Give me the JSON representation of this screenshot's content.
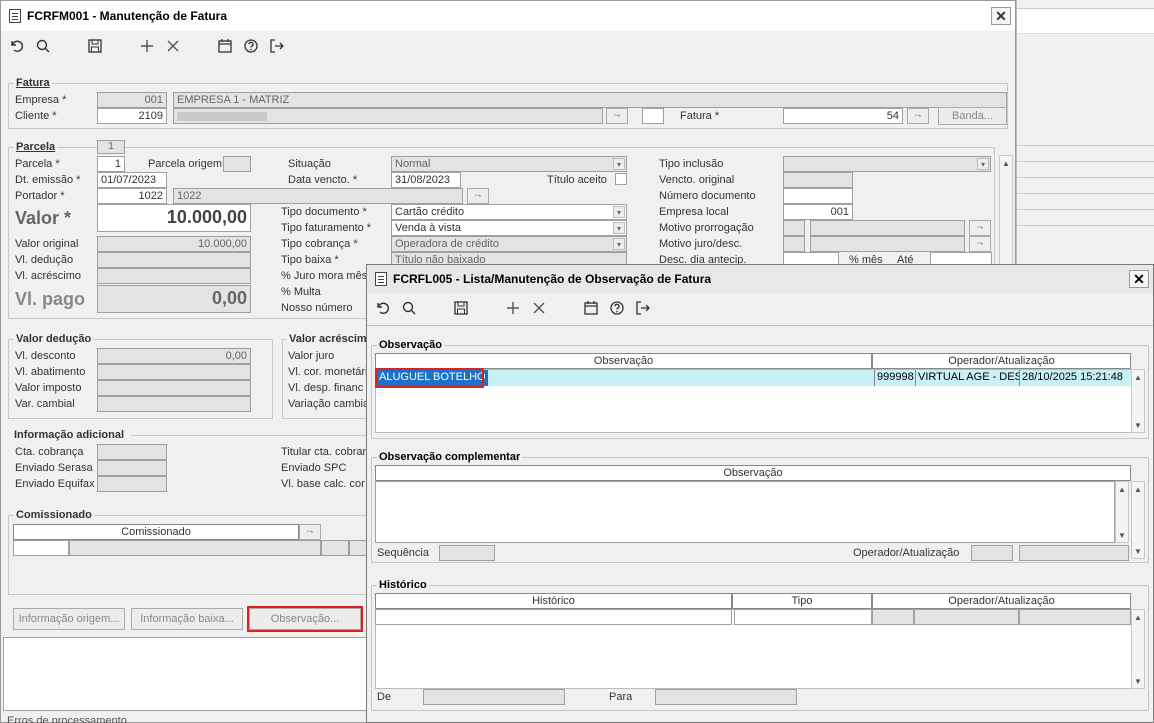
{
  "main_window": {
    "title": "FCRFM001 - Manutenção de Fatura",
    "fatura_group": "Fatura",
    "empresa_label": "Empresa *",
    "empresa_code": "001",
    "empresa_name": "EMPRESA 1 - MATRIZ",
    "cliente_label": "Cliente *",
    "cliente_code": "2109",
    "fatura_label": "Fatura *",
    "fatura_value": "54",
    "banda_button": "Banda...",
    "parcela_group": "Parcela",
    "parcela_tab": "1",
    "parcela_label": "Parcela *",
    "parcela_value": "1",
    "parcela_origem_label": "Parcela origem",
    "situacao_label": "Situação",
    "situacao_value": "Normal",
    "tipo_inclusao_label": "Tipo inclusão",
    "dt_emissao_label": "Dt. emissão *",
    "dt_emissao_value": "01/07/2023",
    "data_vencto_label": "Data vencto. *",
    "data_vencto_value": "31/08/2023",
    "titulo_aceito_label": "Título aceito",
    "vencto_original_label": "Vencto. original",
    "portador_label": "Portador *",
    "portador_code": "1022",
    "portador_name": "1022",
    "numero_documento_label": "Número documento",
    "valor_label": "Valor *",
    "valor_value": "10.000,00",
    "tipo_documento_label": "Tipo documento *",
    "tipo_documento_value": "Cartão crédito",
    "empresa_local_label": "Empresa local",
    "empresa_local_value": "001",
    "tipo_faturamento_label": "Tipo faturamento *",
    "tipo_faturamento_value": "Venda à vista",
    "motivo_prorrogacao_label": "Motivo prorrogação",
    "valor_original_label": "Valor original",
    "valor_original_value": "10.000,00",
    "tipo_cobranca_label": "Tipo cobrança *",
    "tipo_cobranca_value": "Operadora de crédito",
    "motivo_juro_label": "Motivo juro/desc.",
    "vl_deducao_label": "Vl. dedução",
    "tipo_baixa_label": "Tipo baixa *",
    "tipo_baixa_value": "Título não baixado",
    "desc_dia_label": "Desc. dia antecip.",
    "pct_mes_label": "% mês",
    "ate_label": "Até",
    "vl_acrescimo_label": "Vl. acréscimo",
    "juro_mora_label": "% Juro mora mês",
    "vl_pago_label": "Vl. pago",
    "vl_pago_value": "0,00",
    "multa_label": "% Multa",
    "nosso_numero_label": "Nosso número",
    "valor_deducao_group": "Valor dedução",
    "vl_desconto_label": "Vl. desconto",
    "vl_desconto_value": "0,00",
    "vl_abatimento_label": "Vl. abatimento",
    "valor_imposto_label": "Valor imposto",
    "var_cambial_label": "Var. cambial",
    "valor_acrescimo_group": "Valor acréscim",
    "vl_juro_label": "Valor juro",
    "vl_cor_monetaria_label": "Vl. cor. monetári",
    "vl_desp_financ_label": "Vl. desp. financ",
    "variacao_cambial_label": "Variação cambia",
    "info_adicional_group": "Informação adicional",
    "cta_cobranca_label": "Cta. cobrança",
    "enviado_serasa_label": "Enviado Serasa",
    "enviado_equifax_label": "Enviado Equifax",
    "titular_cta_label": "Titular cta. cobran",
    "enviado_spc_label": "Enviado SPC",
    "vl_base_calc_label": "Vl. base calc. cor",
    "comissionado_group": "Comissionado",
    "comissionado_header": "Comissionado",
    "info_origem_button": "Informação origem...",
    "info_baixa_button": "Informação baixa...",
    "observacao_button": "Observação...",
    "status_text": "Erros de processamento"
  },
  "obs_window": {
    "title": "FCRFL005 - Lista/Manutenção de Observação de Fatura",
    "observacao_group": "Observação",
    "col_observacao": "Observação",
    "col_operador": "Operador/Atualização",
    "row_observacao": "ALUGUEL BOTELHO",
    "row_operador_code": "999998",
    "row_operador_name": "VIRTUAL AGE - DESE",
    "row_data": "28/10/2025 15:21:48",
    "obs_complementar_group": "Observação complementar",
    "col_obs_complementar": "Observação",
    "sequencia_label": "Sequência",
    "operador_label": "Operador/Atualização",
    "historico_group": "Histórico",
    "col_historico": "Histórico",
    "col_tipo": "Tipo",
    "col_hist_operador": "Operador/Atualização",
    "de_label": "De",
    "para_label": "Para"
  },
  "colors": {
    "highlight_row": "#c7f0f7",
    "selection": "#1a73c8",
    "red_outline": "#e02020"
  }
}
